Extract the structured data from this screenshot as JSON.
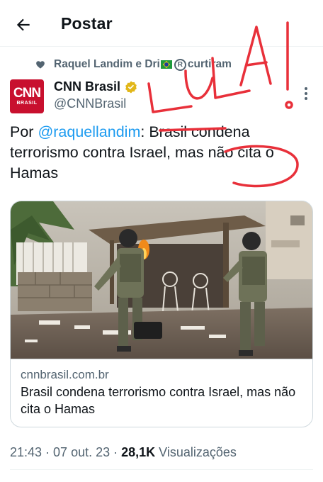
{
  "header": {
    "title": "Postar",
    "back_icon": "arrow-left-icon"
  },
  "social_context": {
    "names_before_flag": "Raquel Landim e Dri",
    "text_after_emoji": " curtiram"
  },
  "author": {
    "name": "CNN Brasil",
    "handle": "@CNNBrasil",
    "avatar_text": "CNN",
    "avatar_subtext": "BRASIL",
    "verified_color": "#e2b719"
  },
  "post": {
    "prefix": "Por ",
    "mention": "@raquellandim",
    "text": ": Brasil condena terrorismo contra Israel, mas não cita o Hamas"
  },
  "link_card": {
    "domain": "cnnbrasil.com.br",
    "title": "Brasil condena terrorismo contra Israel, mas não cita o Hamas"
  },
  "stats": {
    "time_date": "21:43 · 07 out. 23 · ",
    "views_count": "28,1K",
    "views_label": " Visualizações"
  },
  "annotation": {
    "text": "LULA!",
    "color": "#e8303a"
  },
  "colors": {
    "accent": "#1d9bf0",
    "muted": "#536471",
    "brand_red": "#c8102e"
  }
}
